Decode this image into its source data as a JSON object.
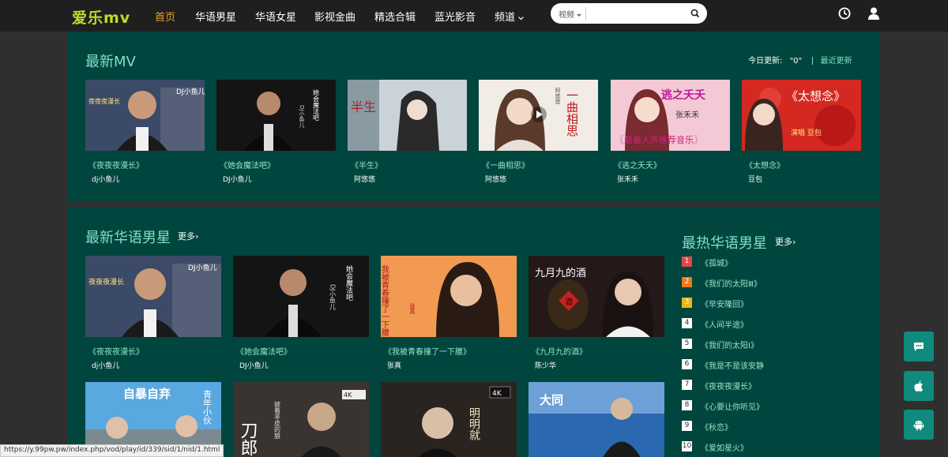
{
  "header": {
    "logo": "爱乐mv",
    "nav": [
      {
        "label": "首页",
        "active": true
      },
      {
        "label": "华语男星"
      },
      {
        "label": "华语女星"
      },
      {
        "label": "影视金曲"
      },
      {
        "label": "精选合辑"
      },
      {
        "label": "蓝光影音"
      },
      {
        "label": "频道"
      }
    ],
    "search": {
      "type_label": "视频",
      "placeholder": "",
      "value": ""
    },
    "icons": [
      "history-icon",
      "user-icon",
      "search-icon"
    ]
  },
  "latest_mv": {
    "title": "最新MV",
    "today_label": "今日更新:",
    "today_count": "\"0\"",
    "recent_link": "最近更新",
    "items": [
      {
        "title": "《夜夜夜漫长》",
        "artist": "dj小鱼儿",
        "thumb_text": "DJ小鱼儿",
        "thumb_sub": "夜夜夜漫长"
      },
      {
        "title": "《她会魔法吧》",
        "artist": "DJ小鱼儿",
        "thumb_text": "她会魔法吧",
        "thumb_sub": "DJ小鱼儿"
      },
      {
        "title": "《半生》",
        "artist": "阿悠悠",
        "thumb_text": "半生",
        "thumb_sub": ""
      },
      {
        "title": "《一曲相思》",
        "artist": "阿悠悠",
        "thumb_text": "一曲相思",
        "thumb_sub": "阿悠悠"
      },
      {
        "title": "《逃之夭夭》",
        "artist": "张禾禾",
        "thumb_text": "逃之夭夭",
        "thumb_sub": "张禾禾",
        "thumb_banner": "〖最春人声推荐音乐〗"
      },
      {
        "title": "《太想念》",
        "artist": "豆包",
        "thumb_text": "《太想念》",
        "thumb_sub": "演唱 豆包"
      }
    ]
  },
  "male_stars": {
    "title": "最新华语男星",
    "more": "更多",
    "items": [
      {
        "title": "《夜夜夜漫长》",
        "artist": "dj小鱼儿",
        "thumb_text": "DJ小鱼儿",
        "thumb_sub": "夜夜夜漫长"
      },
      {
        "title": "《她会魔法吧》",
        "artist": "DJ小鱼儿",
        "thumb_text": "她会魔法吧",
        "thumb_sub": "DJ小鱼儿"
      },
      {
        "title": "《我被青春撞了一下腰》",
        "artist": "张真",
        "thumb_text": "我被青春撞了一下腰",
        "thumb_sub": "张真"
      },
      {
        "title": "《九月九的酒》",
        "artist": "陈少华",
        "thumb_text": "九月九的酒",
        "thumb_sub": "酒"
      },
      {
        "title": "",
        "artist": "",
        "thumb_text": "自暴自弃",
        "thumb_sub": "青年小伙"
      },
      {
        "title": "",
        "artist": "",
        "thumb_text": "刀郎",
        "thumb_sub": "披着羊皮的狼"
      },
      {
        "title": "",
        "artist": "",
        "thumb_text": "明明就",
        "thumb_sub": "4K"
      },
      {
        "title": "",
        "artist": "",
        "thumb_text": "大同",
        "thumb_sub": ""
      }
    ]
  },
  "hot_male": {
    "title": "最热华语男星",
    "more": "更多",
    "ranks": [
      {
        "num": "1",
        "title": "《孤城》",
        "color": "#e64545"
      },
      {
        "num": "2",
        "title": "《我们的太阳Ⅲ》",
        "color": "#f07a18"
      },
      {
        "num": "3",
        "title": "《早安隆回》",
        "color": "#f0b418"
      },
      {
        "num": "4",
        "title": "《人间半途》"
      },
      {
        "num": "5",
        "title": "《我们的太阳Ⅰ》"
      },
      {
        "num": "6",
        "title": "《我是不是该安静"
      },
      {
        "num": "7",
        "title": "《夜夜夜漫长》"
      },
      {
        "num": "8",
        "title": "《心要让你听见》"
      },
      {
        "num": "9",
        "title": "《秋恋》"
      },
      {
        "num": "10",
        "title": "《爱如星火》"
      }
    ]
  },
  "side_buttons": [
    "chat-icon",
    "apple-icon",
    "android-icon"
  ],
  "status_url": "https://y.99pw.pw/index.php/vod/play/id/339/sid/1/nid/1.html",
  "colors": {
    "accent": "#f0a020",
    "panel": "#00463e",
    "link": "#8fe6c8",
    "title": "#7fe0c4",
    "side_button": "#0f8a7c"
  }
}
